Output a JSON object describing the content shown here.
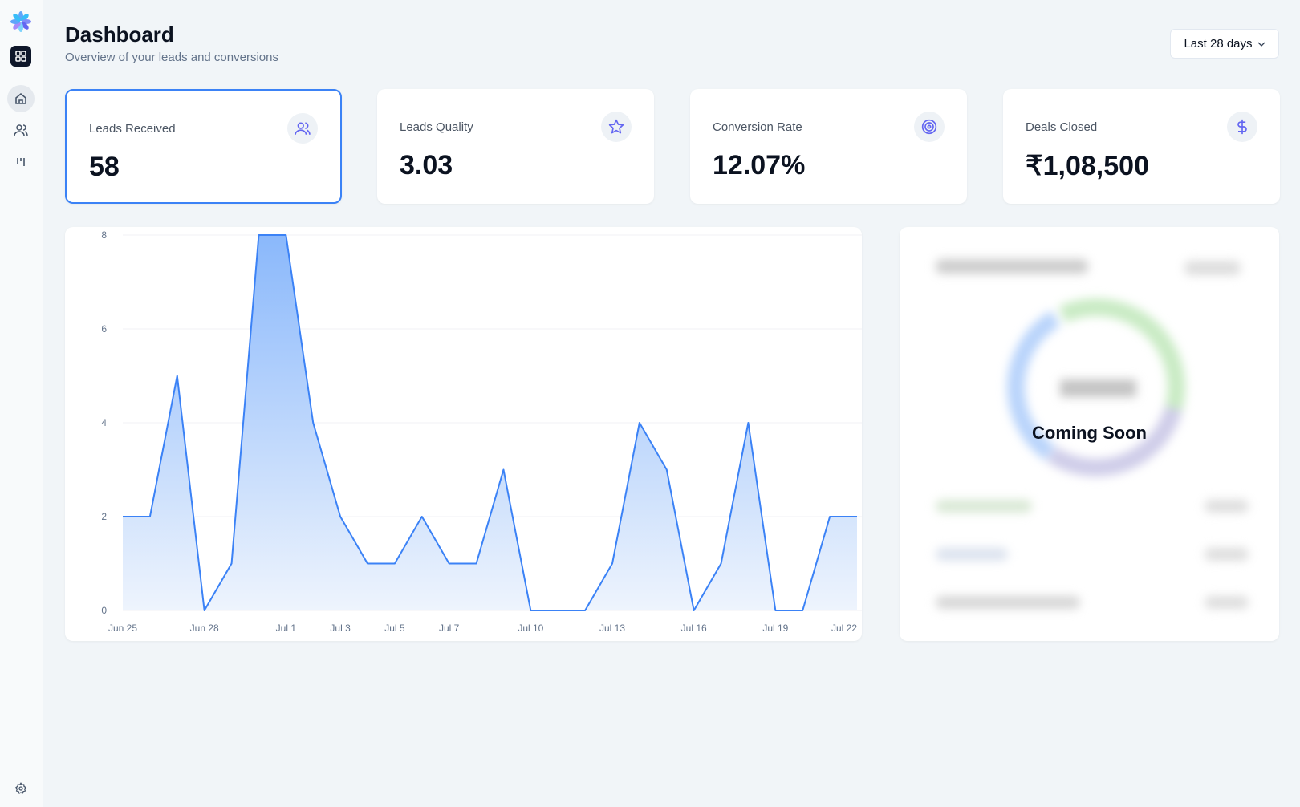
{
  "header": {
    "title": "Dashboard",
    "subtitle": "Overview of your leads and conversions",
    "range_label": "Last 28 days"
  },
  "sidebar": {
    "items": [
      {
        "icon": "logo-flower-icon"
      },
      {
        "icon": "grid-icon"
      },
      {
        "icon": "home-icon",
        "active": true
      },
      {
        "icon": "users-icon"
      },
      {
        "icon": "kanban-icon"
      },
      {
        "icon": "gear-icon"
      }
    ]
  },
  "cards": [
    {
      "label": "Leads Received",
      "value": "58",
      "icon": "users-icon",
      "selected": true
    },
    {
      "label": "Leads Quality",
      "value": "3.03",
      "icon": "star-icon"
    },
    {
      "label": "Conversion Rate",
      "value": "12.07%",
      "icon": "target-icon"
    },
    {
      "label": "Deals Closed",
      "value": "₹1,08,500",
      "icon": "dollar-icon"
    }
  ],
  "right_panel": {
    "overlay_text": "Coming Soon"
  },
  "colors": {
    "accent": "#3b82f6",
    "icon": "#6366f1"
  },
  "chart_data": {
    "type": "area",
    "x": [
      "Jun 25",
      "Jun 26",
      "Jun 27",
      "Jun 28",
      "Jun 29",
      "Jun 30",
      "Jul 1",
      "Jul 2",
      "Jul 3",
      "Jul 4",
      "Jul 5",
      "Jul 6",
      "Jul 7",
      "Jul 8",
      "Jul 9",
      "Jul 10",
      "Jul 11",
      "Jul 12",
      "Jul 13",
      "Jul 14",
      "Jul 15",
      "Jul 16",
      "Jul 17",
      "Jul 18",
      "Jul 19",
      "Jul 20",
      "Jul 21",
      "Jul 22"
    ],
    "values": [
      2,
      2,
      5,
      0,
      1,
      8,
      8,
      4,
      2,
      1,
      1,
      2,
      1,
      1,
      3,
      0,
      0,
      0,
      1,
      4,
      3,
      0,
      1,
      4,
      0,
      0,
      2,
      2
    ],
    "x_tick_labels": [
      "Jun 25",
      "Jun 28",
      "Jul 1",
      "Jul 3",
      "Jul 5",
      "Jul 7",
      "Jul 10",
      "Jul 13",
      "Jul 16",
      "Jul 19",
      "Jul 22"
    ],
    "y_ticks": [
      "0",
      "2",
      "4",
      "6",
      "8"
    ],
    "ylim": [
      0,
      8
    ],
    "grid": true
  }
}
